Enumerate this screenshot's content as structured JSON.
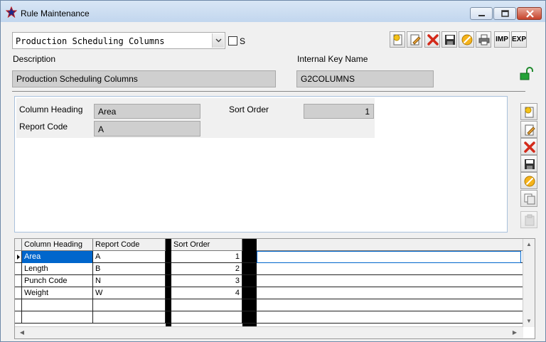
{
  "window": {
    "title": "Rule Maintenance"
  },
  "header": {
    "rule_select": "Production Scheduling Columns",
    "checkbox_label": "S",
    "toolbar": {
      "imp_label": "IMP",
      "exp_label": "EXP"
    }
  },
  "form": {
    "description_label": "Description",
    "description_value": "Production Scheduling Columns",
    "internal_key_label": "Internal Key Name",
    "internal_key_value": "G2COLUMNS"
  },
  "detail": {
    "column_heading_label": "Column Heading",
    "column_heading_value": "Area",
    "report_code_label": "Report Code",
    "report_code_value": "A",
    "sort_order_label": "Sort Order",
    "sort_order_value": "1"
  },
  "grid": {
    "headers": [
      "Column Heading",
      "Report Code",
      "Sort Order"
    ],
    "rows": [
      [
        "Area",
        "A",
        "1"
      ],
      [
        "Length",
        "B",
        "2"
      ],
      [
        "Punch Code",
        "N",
        "3"
      ],
      [
        "Weight",
        "W",
        "4"
      ]
    ]
  },
  "colors": {
    "title_bar": "#c8daf0",
    "field_bg": "#cfcfcf",
    "selected_row": "#0066cc",
    "close_btn": "#c7432b"
  }
}
